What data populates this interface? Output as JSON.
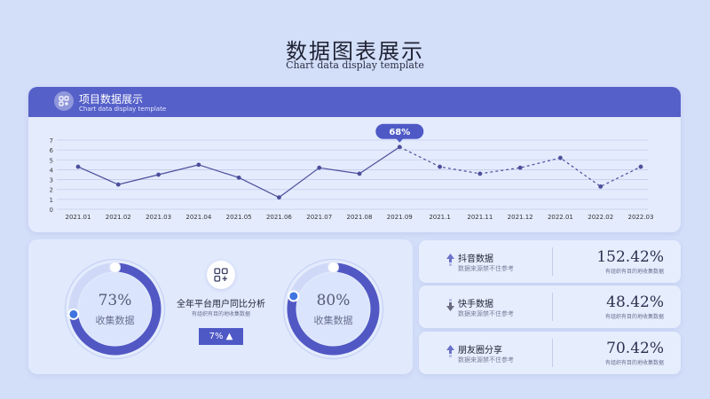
{
  "page": {
    "title": "数据图表展示",
    "subtitle": "Chart data display template"
  },
  "chart_card": {
    "title": "项目数据展示",
    "subtitle": "Chart data display template",
    "icon": "grid-plus-icon",
    "callout": "68%"
  },
  "chart_data": {
    "type": "line",
    "x": [
      "2021.01",
      "2021.02",
      "2021.03",
      "2021.04",
      "2021.05",
      "2021.06",
      "2021.07",
      "2021.08",
      "2021.09",
      "2021.1",
      "2021.11",
      "2021.12",
      "2022.01",
      "2022.02",
      "2022.03"
    ],
    "series": [
      {
        "values": [
          4.3,
          2.5,
          3.5,
          4.5,
          3.2,
          1.2,
          4.2,
          3.6,
          6.3,
          4.3,
          3.6,
          4.2,
          5.2,
          2.3,
          4.3
        ]
      }
    ],
    "actual_through_index": 8,
    "projected_style": "dashed",
    "ylim": [
      0,
      7
    ],
    "yticks": [
      0,
      1,
      2,
      3,
      4,
      5,
      6,
      7
    ],
    "grid": true,
    "line_color": "#4c4f9a"
  },
  "donut_left": {
    "value": 73,
    "label_pct": "73%",
    "label": "收集数据"
  },
  "donut_right": {
    "value": 80,
    "label_pct": "80%",
    "label": "收集数据"
  },
  "comparison": {
    "icon": "grid-plus-icon",
    "title": "全年平台用户同比分析",
    "subtitle": "有组织有目的地收集数据",
    "badge": "7% ▲"
  },
  "stats": [
    {
      "name": "抖音数据",
      "desc": "数据来源禁不住参考",
      "value": "152.42%",
      "sub": "有组织有目的地收集数据",
      "arrow": "up"
    },
    {
      "name": "快手数据",
      "desc": "数据来源禁不住参考",
      "value": "48.42%",
      "sub": "有组织有目的地收集数据",
      "arrow": "down"
    },
    {
      "name": "朋友圈分享",
      "desc": "数据来源禁不住参考",
      "value": "70.42%",
      "sub": "有组织有目的地收集数据",
      "arrow": "up"
    }
  ],
  "colors": {
    "accent": "#5560c8",
    "donut_arc": "#5158c4",
    "donut_track": "#cfd9f7",
    "background": "#d3def9"
  }
}
